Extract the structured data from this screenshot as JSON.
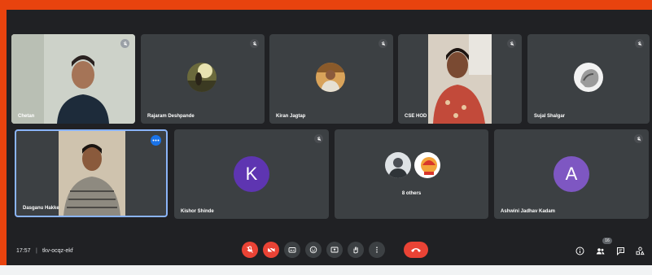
{
  "meeting": {
    "time": "17:57",
    "separator": "|",
    "code": "tkv-ocqz-ekf",
    "participant_count_badge": "16"
  },
  "participants": [
    {
      "name": "Chetan",
      "type": "video"
    },
    {
      "name": "Rajaram Deshpande",
      "type": "photo"
    },
    {
      "name": "Kiran Jagtap",
      "type": "photo"
    },
    {
      "name": "CSE HOD",
      "type": "video"
    },
    {
      "name": "Sujal Shalgar",
      "type": "photo"
    },
    {
      "name": "Dasganu Hakke",
      "type": "video"
    },
    {
      "name": "Kishor Shinde",
      "type": "letter",
      "letter": "K",
      "color": "#5e35b1"
    },
    {
      "name": "8 others",
      "type": "group"
    },
    {
      "name": "Ashwini Jadhav Kadam",
      "type": "letter",
      "letter": "A",
      "color": "#7e57c2"
    }
  ],
  "colors": {
    "background": "#202124",
    "tile": "#3c4043",
    "frame": "#e8430e",
    "danger": "#ea4335",
    "active_border": "#8ab4f8"
  },
  "controls": [
    "mic-off-icon",
    "camera-off-icon",
    "captions-icon",
    "emoji-icon",
    "present-icon",
    "raise-hand-icon",
    "more-options-icon",
    "end-call-icon"
  ],
  "right_controls": [
    "info-icon",
    "people-icon",
    "chat-icon",
    "activities-icon"
  ]
}
